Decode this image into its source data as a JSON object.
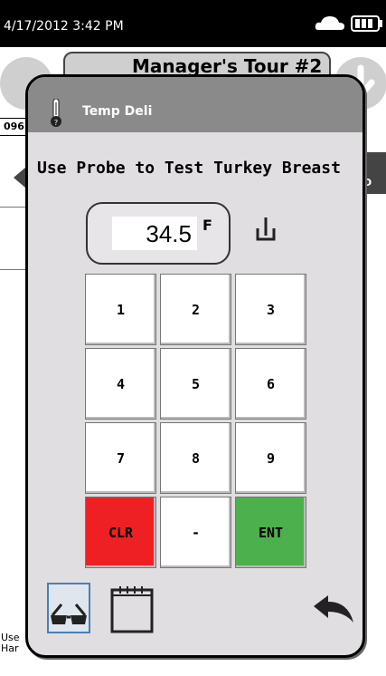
{
  "status_bar": {
    "datetime": "4/17/2012 3:42 PM",
    "cloud_icon": "cloud-icon",
    "battery_icon": "battery-icon"
  },
  "background": {
    "title": "Manager's Tour #2",
    "id_fragment": "096",
    "right_tab_fragment": "D",
    "note_line1": "Use",
    "note_line2": "Har"
  },
  "dialog": {
    "title": "Temp Deli",
    "prompt": "Use Probe to Test Turkey Breast",
    "temperature": {
      "value": "34.5",
      "unit": "F"
    },
    "keypad": [
      {
        "label": "1"
      },
      {
        "label": "2"
      },
      {
        "label": "3"
      },
      {
        "label": "4"
      },
      {
        "label": "5"
      },
      {
        "label": "6"
      },
      {
        "label": "7"
      },
      {
        "label": "8"
      },
      {
        "label": "9"
      },
      {
        "label": "CLR",
        "color": "#ee2024"
      },
      {
        "label": "-"
      },
      {
        "label": "ENT",
        "color": "#4cb04c"
      }
    ],
    "bottom_icons": [
      "glasses-icon",
      "notepad-icon",
      "back-arrow-icon"
    ]
  }
}
